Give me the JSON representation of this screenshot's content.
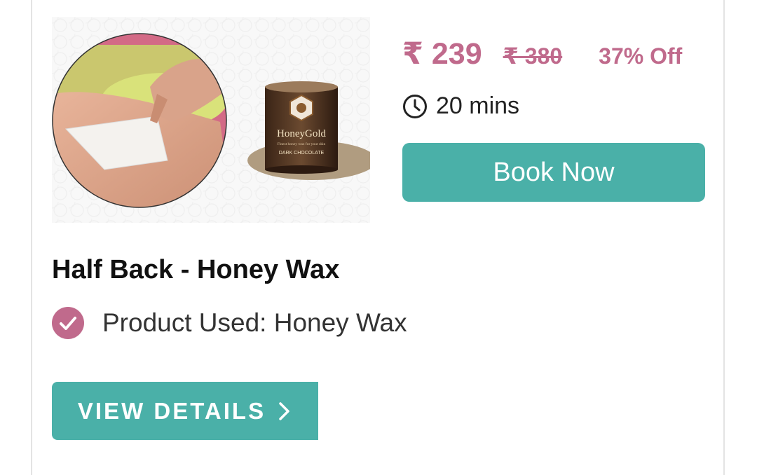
{
  "service": {
    "price": "₹ 239",
    "original_price": "₹ 380",
    "discount": "37% Off",
    "duration": "20 mins",
    "book_label": "Book Now",
    "title": "Half Back - Honey Wax",
    "product_used": "Product Used: Honey Wax",
    "details_label": "VIEW DETAILS",
    "product_brand": "HoneyGold",
    "product_tagline": "Finest honey wax for your skin",
    "product_variant": "DARK CHOCOLATE"
  },
  "colors": {
    "accent_pink": "#c06a8c",
    "button_teal": "#4ab0a8"
  },
  "icons": {
    "duration": "clock-icon",
    "product": "check-circle-icon",
    "details": "chevron-right-icon"
  }
}
